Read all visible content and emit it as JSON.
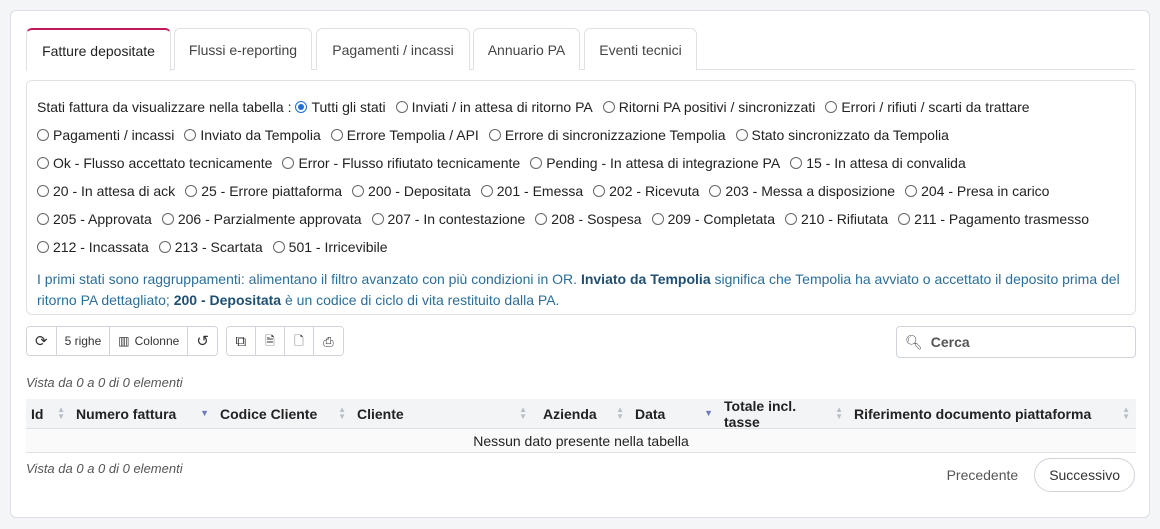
{
  "tabs": [
    {
      "label": "Fatture depositate",
      "active": true
    },
    {
      "label": "Flussi e-reporting"
    },
    {
      "label": "Pagamenti / incassi"
    },
    {
      "label": "Annuario PA"
    },
    {
      "label": "Eventi tecnici"
    }
  ],
  "filter": {
    "label": "Stati fattura da visualizzare nella tabella :",
    "rows": [
      [
        "Tutti gli stati",
        "Inviati / in attesa di ritorno PA",
        "Ritorni PA positivi / sincronizzati",
        "Errori / rifiuti / scarti da trattare"
      ],
      [
        "Pagamenti / incassi",
        "Inviato da Tempolia",
        "Errore Tempolia / API",
        "Errore di sincronizzazione Tempolia",
        "Stato sincronizzato da Tempolia"
      ],
      [
        "Ok - Flusso accettato tecnicamente",
        "Error - Flusso rifiutato tecnicamente",
        "Pending - In attesa di integrazione PA",
        "15 - In attesa di convalida"
      ],
      [
        "20 - In attesa di ack",
        "25 - Errore piattaforma",
        "200 - Depositata",
        "201 - Emessa",
        "202 - Ricevuta",
        "203 - Messa a disposizione",
        "204 - Presa in carico"
      ],
      [
        "205 - Approvata",
        "206 - Parzialmente approvata",
        "207 - In contestazione",
        "208 - Sospesa",
        "209 - Completata",
        "210 - Rifiutata",
        "211 - Pagamento trasmesso"
      ],
      [
        "212 - Incassata",
        "213 - Scartata",
        "501 - Irricevibile"
      ]
    ],
    "selected": "Tutti gli stati",
    "note_part1": "I primi stati sono raggruppamenti: alimentano il filtro avanzato con più condizioni in OR. ",
    "note_bold1": "Inviato da Tempolia",
    "note_part2": " significa che Tempolia ha avviato o accettato il deposito prima del ritorno PA dettagliato; ",
    "note_bold2": "200 - Depositata",
    "note_part3": " è un codice di ciclo di vita restituito dalla PA."
  },
  "toolbar": {
    "rows_label": "5 righe",
    "columns_label": "Colonne",
    "icons": [
      "refresh-icon",
      "columns-icon",
      "undo-icon",
      "copy-icon",
      "excel-icon",
      "pdf-icon",
      "print-icon"
    ]
  },
  "search": {
    "placeholder": "Cerca"
  },
  "info_top": "Vista da 0 a 0 di 0 elementi",
  "info_bottom": "Vista da 0 a 0 di 0 elementi",
  "table": {
    "columns": [
      "Id",
      "Numero fattura",
      "Codice Cliente",
      "Cliente",
      "Azienda",
      "Data",
      "Totale incl. tasse",
      "Riferimento documento piattaforma"
    ],
    "empty": "Nessun dato presente nella tabella"
  },
  "pager": {
    "prev": "Precedente",
    "next": "Successivo"
  },
  "colors": {
    "accent": "#c2185b",
    "radio": "#1e6fd9",
    "note": "#2b6e9a"
  }
}
